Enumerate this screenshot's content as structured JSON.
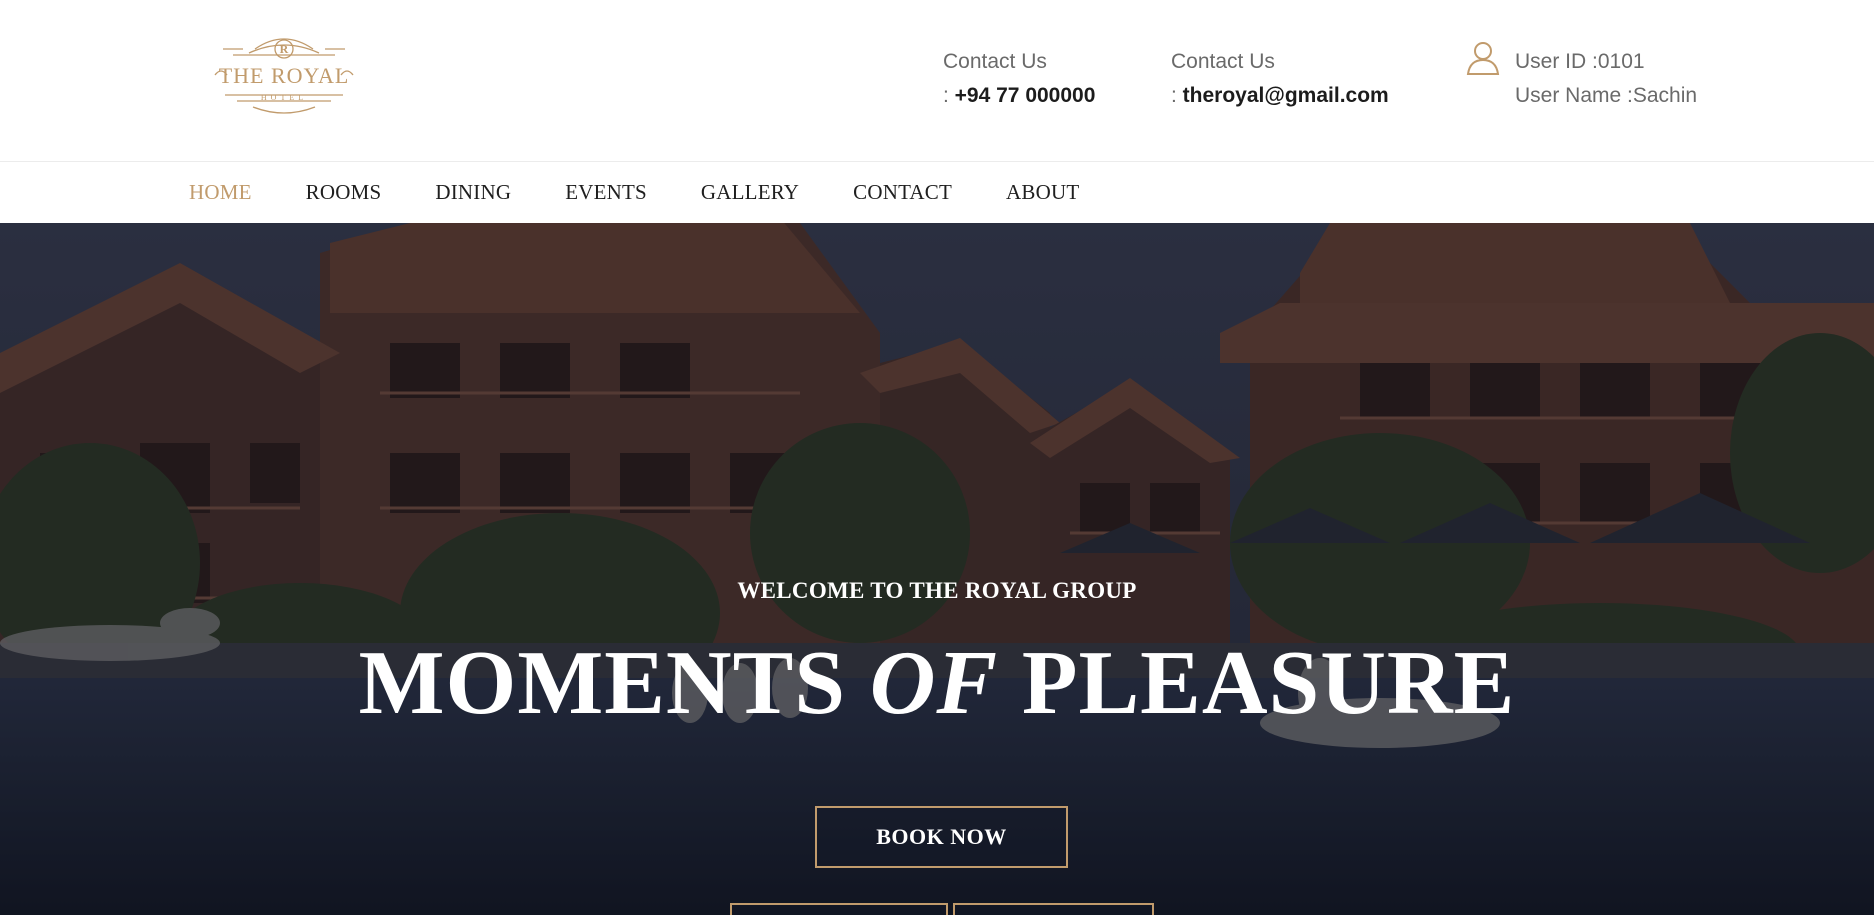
{
  "brand": {
    "logo_letter": "R",
    "logo_name": "THE ROYAL",
    "logo_sub": "HOTEL",
    "colors": {
      "accent": "#c19b6c",
      "text_dark": "#1f1f1f",
      "text_muted": "#6a6a6a"
    }
  },
  "contacts": [
    {
      "label": "Contact Us",
      "prefix": ": ",
      "value": "+94 77 000000"
    },
    {
      "label": "Contact Us",
      "prefix": ": ",
      "value": "theroyal@gmail.com"
    }
  ],
  "user": {
    "icon": "user-icon",
    "id_line": "User ID :0101",
    "name_line": "User Name :Sachin"
  },
  "nav": {
    "items": [
      {
        "label": "HOME",
        "active": true
      },
      {
        "label": "ROOMS",
        "active": false
      },
      {
        "label": "DINING",
        "active": false
      },
      {
        "label": "EVENTS",
        "active": false
      },
      {
        "label": "GALLERY",
        "active": false
      },
      {
        "label": "CONTACT",
        "active": false
      },
      {
        "label": "ABOUT",
        "active": false
      }
    ]
  },
  "hero": {
    "subtitle": "WELCOME TO THE ROYAL GROUP",
    "title_part1": "MOMENTS ",
    "title_italic": "OF",
    "title_part2": " PLEASURE",
    "book_label": "BOOK NOW"
  }
}
